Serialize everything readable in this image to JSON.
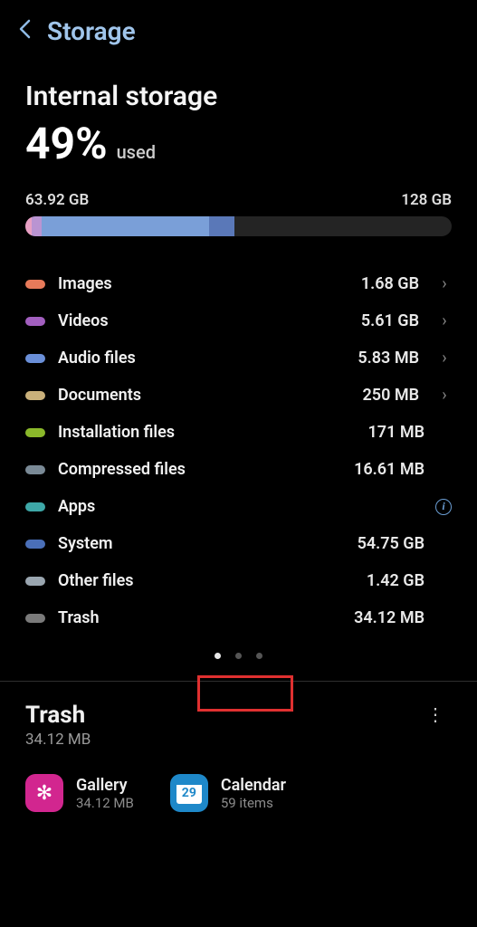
{
  "header": {
    "title": "Storage"
  },
  "internal": {
    "title": "Internal storage",
    "percent": "49%",
    "used_label": "used",
    "used_amount": "63.92 GB",
    "total_amount": "128 GB",
    "bar_fill_pct": 49,
    "bar_segments": [
      {
        "color": "#e8a0c4",
        "pct": 3
      },
      {
        "color": "#ba94d2",
        "pct": 5
      },
      {
        "color": "#7a9fd8",
        "pct": 80
      },
      {
        "color": "#5a78b8",
        "pct": 12
      }
    ]
  },
  "categories": [
    {
      "color": "#e77a5a",
      "label": "Images",
      "size": "1.68 GB",
      "chevron": true,
      "info": false
    },
    {
      "color": "#a25fbf",
      "label": "Videos",
      "size": "5.61 GB",
      "chevron": true,
      "info": false
    },
    {
      "color": "#6a8fd8",
      "label": "Audio files",
      "size": "5.83 MB",
      "chevron": true,
      "info": false
    },
    {
      "color": "#c9b07a",
      "label": "Documents",
      "size": "250 MB",
      "chevron": true,
      "info": false
    },
    {
      "color": "#8ab82a",
      "label": "Installation files",
      "size": "171 MB",
      "chevron": false,
      "info": false
    },
    {
      "color": "#7a8a96",
      "label": "Compressed files",
      "size": "16.61 MB",
      "chevron": false,
      "info": false
    },
    {
      "color": "#3ea8a8",
      "label": "Apps",
      "size": "",
      "chevron": false,
      "info": true
    },
    {
      "color": "#4a6fb8",
      "label": "System",
      "size": "54.75 GB",
      "chevron": false,
      "info": false
    },
    {
      "color": "#9aa6b0",
      "label": "Other files",
      "size": "1.42 GB",
      "chevron": false,
      "info": false
    },
    {
      "color": "#7a7a7a",
      "label": "Trash",
      "size": "34.12 MB",
      "chevron": false,
      "info": false
    }
  ],
  "pager": {
    "count": 3,
    "active": 0
  },
  "trash": {
    "title": "Trash",
    "size": "34.12 MB",
    "items": [
      {
        "kind": "gallery",
        "label": "Gallery",
        "sub": "34.12 MB"
      },
      {
        "kind": "calendar",
        "label": "Calendar",
        "sub": "59 items",
        "badge": "29"
      }
    ]
  }
}
